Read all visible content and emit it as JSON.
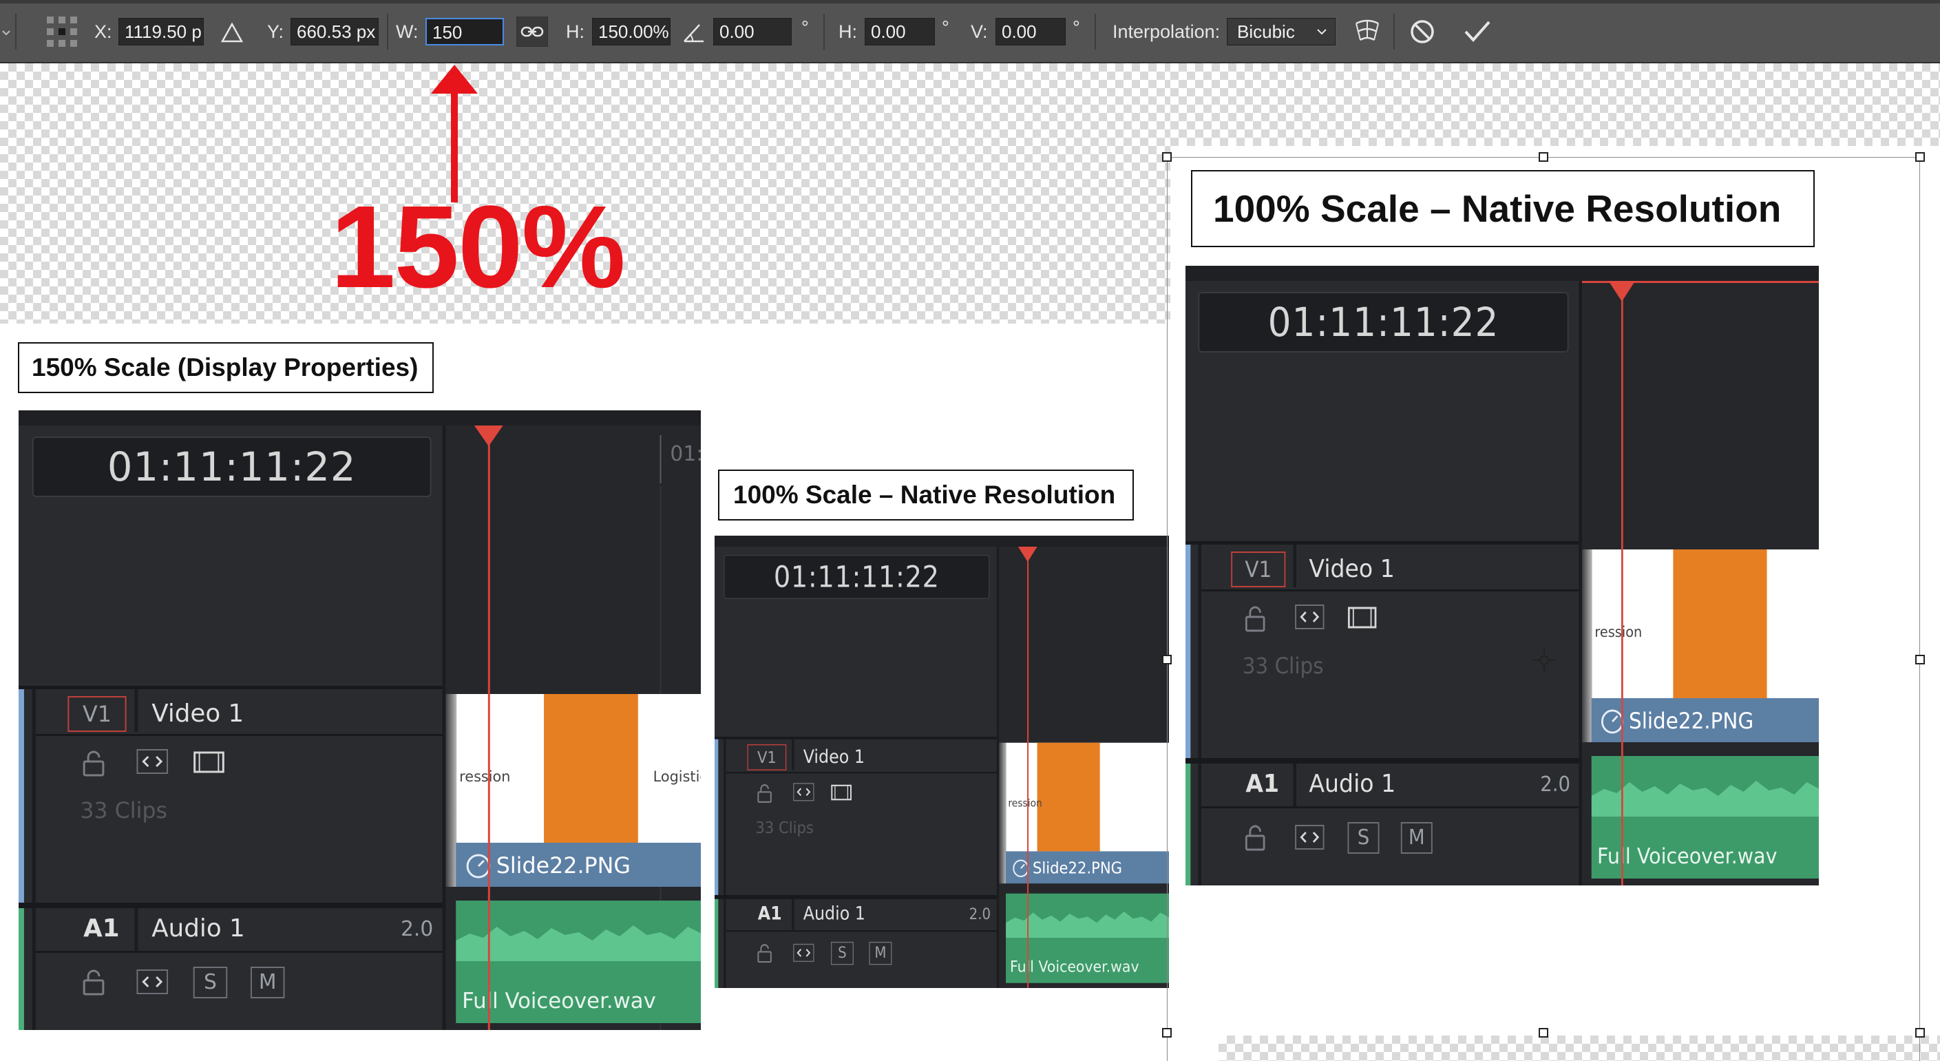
{
  "toolbar": {
    "x_label": "X:",
    "x_value": "1119.50 p",
    "y_label": "Y:",
    "y_value": "660.53 px",
    "w_label": "W:",
    "w_value": "150",
    "h_label": "H:",
    "h_value": "150.00%",
    "angle_value": "0.00",
    "degree_symbol": "°",
    "skew_h_label": "H:",
    "skew_h_value": "0.00",
    "skew_v_label": "V:",
    "skew_v_value": "0.00",
    "interpolation_label": "Interpolation:",
    "interpolation_value": "Bicubic",
    "icons": [
      "reference-point-icon",
      "delta-icon",
      "link-icon",
      "angle-icon",
      "warp-icon",
      "cancel-icon",
      "commit-icon"
    ]
  },
  "annotation": {
    "big_percent": "150%",
    "color": "#e8141b"
  },
  "labels": {
    "left": "150% Scale (Display Properties)",
    "middle": "100% Scale – Native Resolution",
    "right": "100% Scale – Native Resolution"
  },
  "panel": {
    "timecode": "01:11:11:22",
    "ruler_partial": "01:",
    "video_track_badge": "V1",
    "video_track_name": "Video 1",
    "clip_count": "33 Clips",
    "video_clip_name": "Slide22.PNG",
    "slide_text_left": "ression",
    "slide_text_right": "Logistic F",
    "audio_track_badge": "A1",
    "audio_track_name": "Audio 1",
    "audio_channels": "2.0",
    "solo_label": "S",
    "mute_label": "M",
    "audio_clip_name": "Full Voiceover.wav",
    "colors": {
      "playhead": "#e0473c",
      "video_clip_bar": "#5c7fa4",
      "audio_clip": "#3d9b6a",
      "orange": "#e67e22"
    }
  }
}
